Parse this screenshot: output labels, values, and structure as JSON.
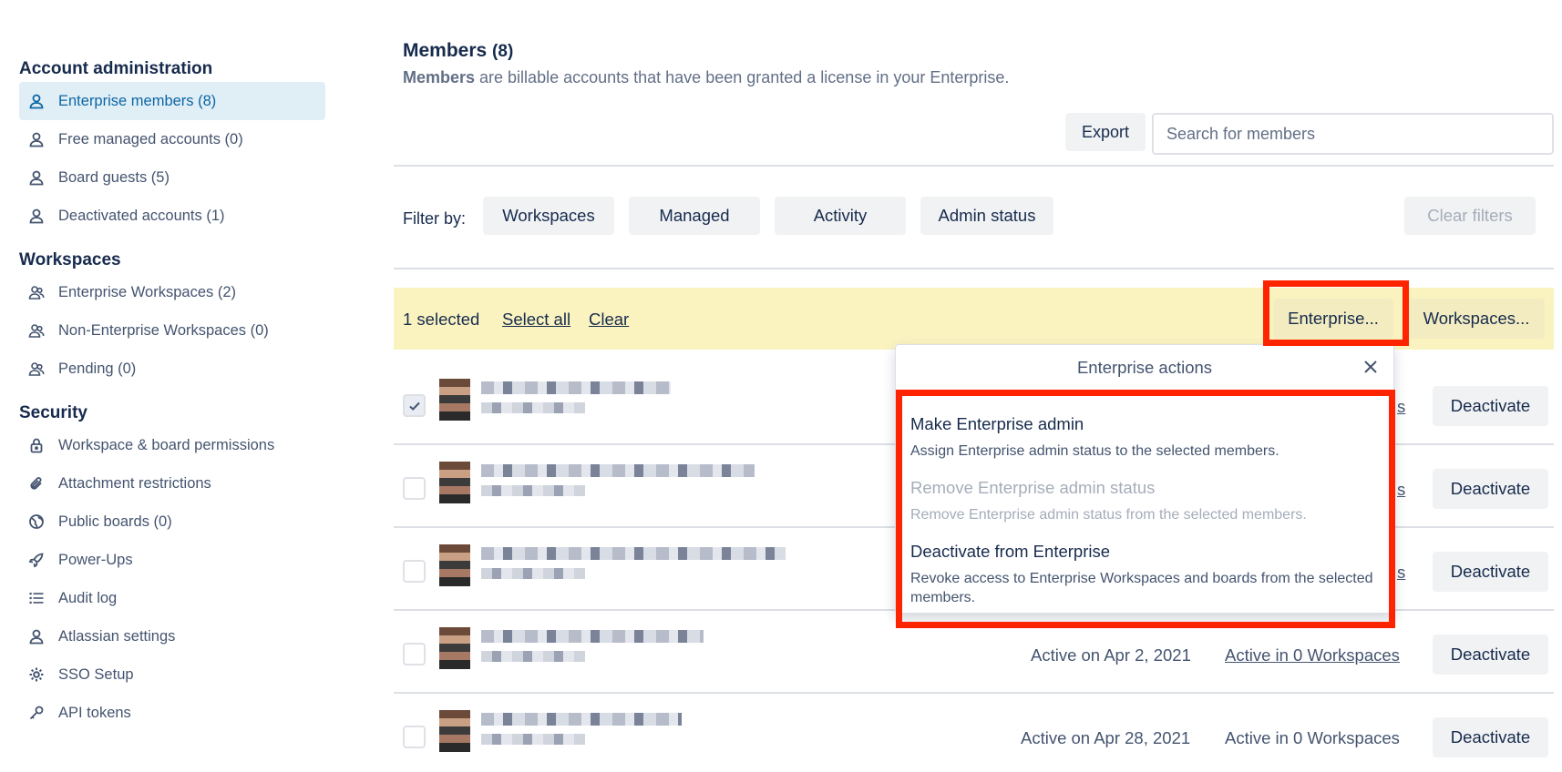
{
  "sidebar": {
    "sections": [
      {
        "title": "Account administration",
        "items": [
          {
            "label": "Enterprise members (8)",
            "icon": "person-icon",
            "active": true
          },
          {
            "label": "Free managed accounts (0)",
            "icon": "person-icon"
          },
          {
            "label": "Board guests (5)",
            "icon": "person-icon"
          },
          {
            "label": "Deactivated accounts (1)",
            "icon": "person-icon"
          }
        ]
      },
      {
        "title": "Workspaces",
        "items": [
          {
            "label": "Enterprise Workspaces (2)",
            "icon": "team-icon"
          },
          {
            "label": "Non-Enterprise Workspaces (0)",
            "icon": "team-icon"
          },
          {
            "label": "Pending (0)",
            "icon": "team-icon"
          }
        ]
      },
      {
        "title": "Security",
        "items": [
          {
            "label": "Workspace & board permissions",
            "icon": "lock-icon"
          },
          {
            "label": "Attachment restrictions",
            "icon": "paperclip-icon"
          },
          {
            "label": "Public boards (0)",
            "icon": "globe-icon"
          },
          {
            "label": "Power-Ups",
            "icon": "rocket-icon"
          },
          {
            "label": "Audit log",
            "icon": "list-icon"
          },
          {
            "label": "Atlassian settings",
            "icon": "person-icon"
          },
          {
            "label": "SSO Setup",
            "icon": "gear-icon"
          },
          {
            "label": "API tokens",
            "icon": "key-icon"
          }
        ]
      }
    ]
  },
  "header": {
    "title": "Members",
    "count": "(8)",
    "subtitle_bold": "Members",
    "subtitle_rest": " are billable accounts that have been granted a license in your Enterprise."
  },
  "toolbar": {
    "export_label": "Export",
    "search_placeholder": "Search for members"
  },
  "filters": {
    "label": "Filter by:",
    "buttons": [
      "Workspaces",
      "Managed",
      "Activity",
      "Admin status"
    ],
    "clear_label": "Clear filters"
  },
  "selection": {
    "count_text": "1 selected",
    "select_all": "Select all",
    "clear": "Clear",
    "enterprise_btn": "Enterprise...",
    "workspaces_btn": "Workspaces..."
  },
  "popover": {
    "title": "Enterprise actions",
    "items": [
      {
        "title": "Make Enterprise admin",
        "desc": "Assign Enterprise admin status to the selected members.",
        "disabled": false
      },
      {
        "title": "Remove Enterprise admin status",
        "desc": "Remove Enterprise admin status from the selected members.",
        "disabled": true
      },
      {
        "title": "Deactivate from Enterprise",
        "desc": "Revoke access to Enterprise Workspaces and boards from the selected members.",
        "disabled": false
      }
    ]
  },
  "rows": [
    {
      "checked": true,
      "active_on": "",
      "workspaces": "s",
      "deactivate": "Deactivate"
    },
    {
      "checked": false,
      "active_on": "",
      "workspaces": "s",
      "deactivate": "Deactivate"
    },
    {
      "checked": false,
      "active_on": "",
      "workspaces": "s",
      "deactivate": "Deactivate"
    },
    {
      "checked": false,
      "active_on": "Active on Apr 2, 2021",
      "workspaces": "Active in 0 Workspaces",
      "deactivate": "Deactivate"
    },
    {
      "checked": false,
      "active_on": "Active on Apr 28, 2021",
      "workspaces": "Active in 0 Workspaces",
      "deactivate": "Deactivate"
    }
  ],
  "colors": {
    "accent": "#0c66a4",
    "active_bg": "#e0eef6",
    "selection_bg": "#faf3c0",
    "highlight": "#ff2400"
  }
}
